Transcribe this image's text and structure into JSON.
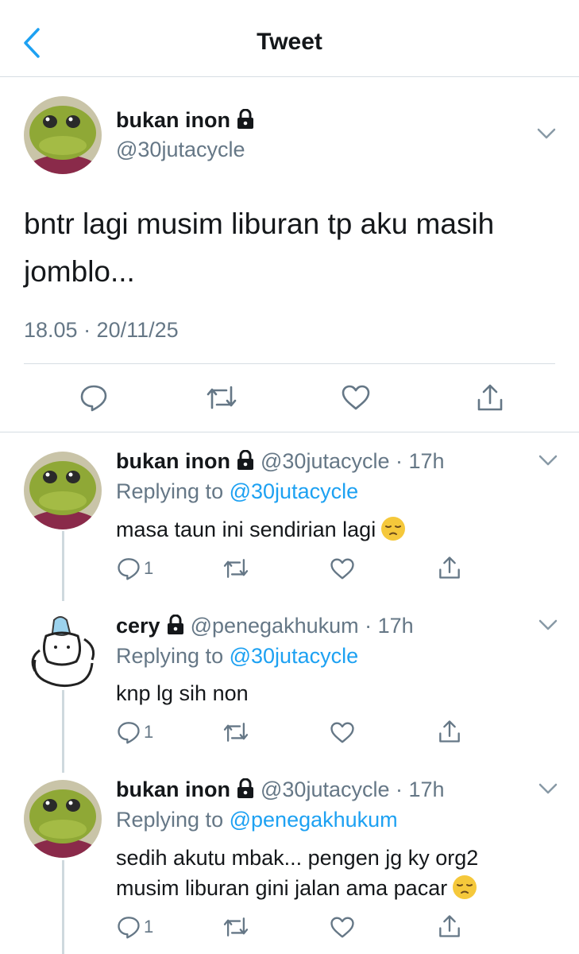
{
  "nav": {
    "title": "Tweet"
  },
  "main_tweet": {
    "display_name": "bukan inon",
    "handle": "@30jutacycle",
    "text": "bntr lagi musim liburan tp aku masih jomblo...",
    "timestamp": "18.05 · 20/11/25"
  },
  "replies": [
    {
      "display_name": "bukan inon",
      "meta": "@30jutacycle · 17h",
      "replying_prefix": "Replying to",
      "replying_to": "@30jutacycle",
      "text": "masa taun ini sendirian lagi",
      "emoji": "pensive-face",
      "reply_count": "1"
    },
    {
      "display_name": "cery",
      "meta": "@penegakhukum · 17h",
      "replying_prefix": "Replying to",
      "replying_to": "@30jutacycle",
      "text": "knp lg sih non",
      "reply_count": "1"
    },
    {
      "display_name": "bukan inon",
      "meta": "@30jutacycle · 17h",
      "replying_prefix": "Replying to",
      "replying_to": "@penegakhukum",
      "text": "sedih akutu mbak... pengen jg ky org2 musim liburan gini jalan ama pacar",
      "emoji": "pensive-face",
      "reply_count": "1"
    }
  ],
  "colors": {
    "link": "#1da1f2",
    "secondary_text": "#657786",
    "divider": "#d6dde3"
  }
}
